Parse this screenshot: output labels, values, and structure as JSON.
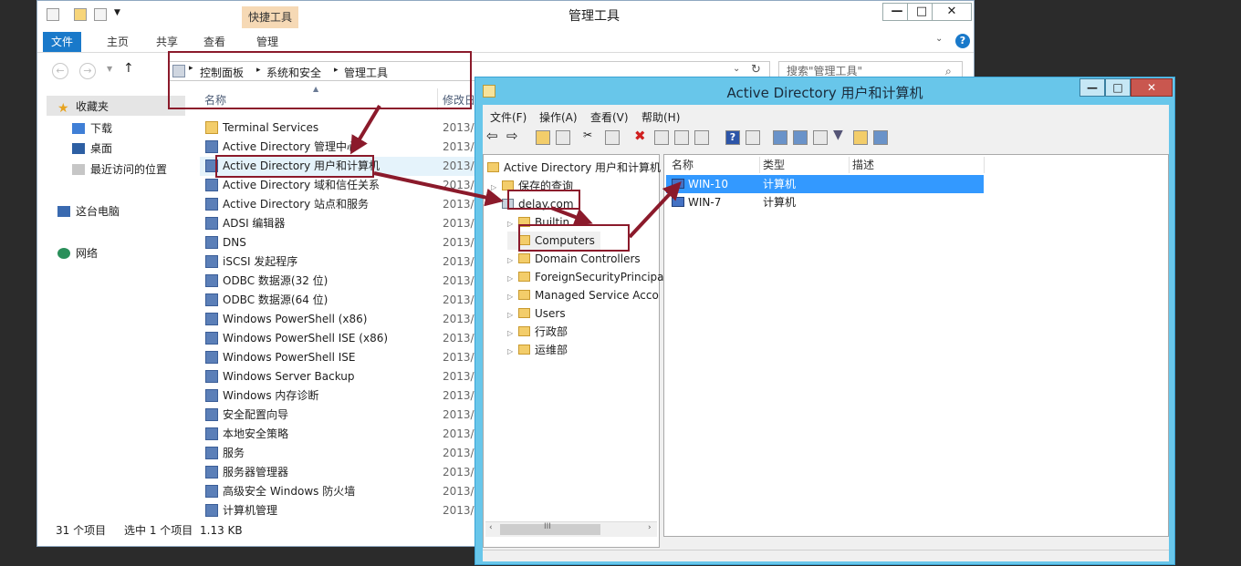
{
  "explorer": {
    "title": "管理工具",
    "ribbon_context_label": "快捷工具",
    "tabs": [
      "文件",
      "主页",
      "共享",
      "查看",
      "管理"
    ],
    "breadcrumb": [
      "控制面板",
      "系统和安全",
      "管理工具"
    ],
    "search_placeholder": "搜索\"管理工具\"",
    "nav": {
      "favorites": "收藏夹",
      "downloads": "下载",
      "desktop": "桌面",
      "recent": "最近访问的位置",
      "thispc": "这台电脑",
      "network": "网络"
    },
    "columns": {
      "name": "名称",
      "modified": "修改日"
    },
    "files": [
      {
        "name": "Terminal Services",
        "date": "2013/"
      },
      {
        "name": "Active Directory 管理中心",
        "date": "2013/"
      },
      {
        "name": "Active Directory 用户和计算机",
        "date": "2013/"
      },
      {
        "name": "Active Directory 域和信任关系",
        "date": "2013/"
      },
      {
        "name": "Active Directory 站点和服务",
        "date": "2013/"
      },
      {
        "name": "ADSI 编辑器",
        "date": "2013/"
      },
      {
        "name": "DNS",
        "date": "2013/"
      },
      {
        "name": "iSCSI 发起程序",
        "date": "2013/"
      },
      {
        "name": "ODBC 数据源(32 位)",
        "date": "2013/"
      },
      {
        "name": "ODBC 数据源(64 位)",
        "date": "2013/"
      },
      {
        "name": "Windows PowerShell (x86)",
        "date": "2013/"
      },
      {
        "name": "Windows PowerShell ISE (x86)",
        "date": "2013/"
      },
      {
        "name": "Windows PowerShell ISE",
        "date": "2013/"
      },
      {
        "name": "Windows Server Backup",
        "date": "2013/"
      },
      {
        "name": "Windows 内存诊断",
        "date": "2013/"
      },
      {
        "name": "安全配置向导",
        "date": "2013/"
      },
      {
        "name": "本地安全策略",
        "date": "2013/"
      },
      {
        "name": "服务",
        "date": "2013/"
      },
      {
        "name": "服务器管理器",
        "date": "2013/"
      },
      {
        "name": "高级安全 Windows 防火墙",
        "date": "2013/"
      },
      {
        "name": "计算机管理",
        "date": "2013/"
      }
    ],
    "status": {
      "count": "31 个项目",
      "selected": "选中 1 个项目",
      "size": "1.13 KB"
    }
  },
  "ad": {
    "title": "Active Directory 用户和计算机",
    "menu": [
      "文件(F)",
      "操作(A)",
      "查看(V)",
      "帮助(H)"
    ],
    "tree_root": "Active Directory 用户和计算机",
    "tree": [
      {
        "label": "保存的查询"
      },
      {
        "label": "delay.com"
      },
      {
        "label": "Builtin"
      },
      {
        "label": "Computers"
      },
      {
        "label": "Domain Controllers"
      },
      {
        "label": "ForeignSecurityPrincipa"
      },
      {
        "label": "Managed Service Acco"
      },
      {
        "label": "Users"
      },
      {
        "label": "行政部"
      },
      {
        "label": "运维部"
      }
    ],
    "columns": {
      "name": "名称",
      "type": "类型",
      "desc": "描述"
    },
    "rows": [
      {
        "name": "WIN-10",
        "type": "计算机"
      },
      {
        "name": "WIN-7",
        "type": "计算机"
      }
    ],
    "hscroll_label": "III"
  },
  "colors": {
    "annotation": "#8b1a2b",
    "accent": "#1979ca",
    "selection": "#3399ff",
    "ad_title_bg": "#68c6ea"
  }
}
